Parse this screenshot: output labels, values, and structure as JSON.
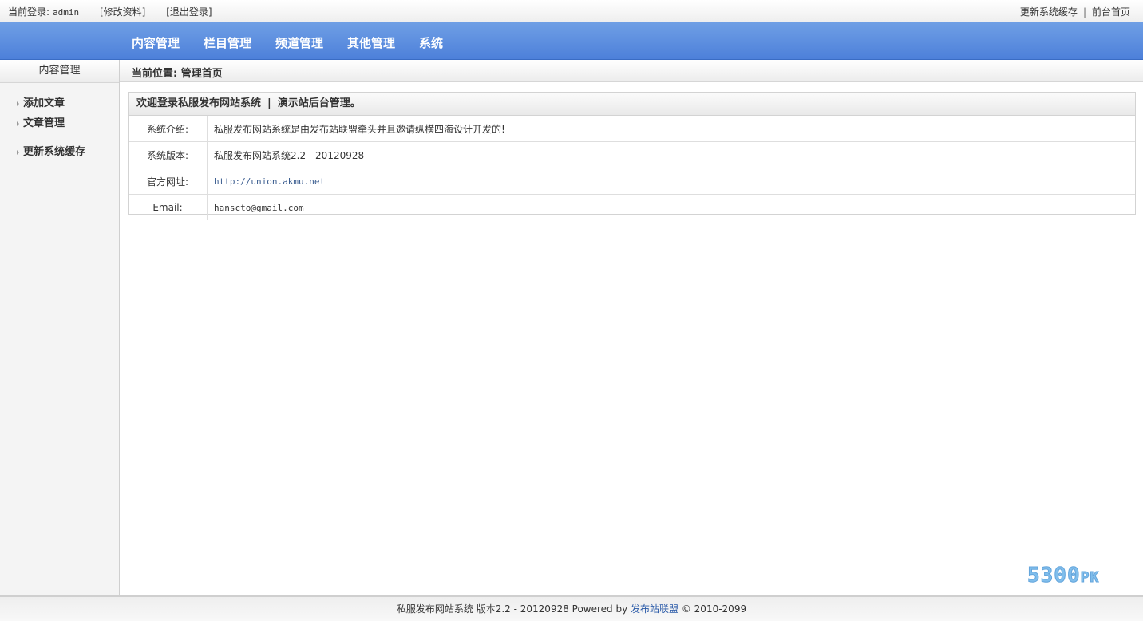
{
  "topbar": {
    "login_label": "当前登录:",
    "username": "admin",
    "edit_profile": "[修改资料]",
    "logout": "[退出登录]",
    "update_cache": "更新系统缓存",
    "separator": "|",
    "front_home": "前台首页"
  },
  "nav": {
    "items": [
      "内容管理",
      "栏目管理",
      "频道管理",
      "其他管理",
      "系统"
    ]
  },
  "sidebar": {
    "title": "内容管理",
    "items": [
      "添加文章",
      "文章管理",
      "更新系统缓存"
    ]
  },
  "breadcrumb": {
    "text": "当前位置: 管理首页"
  },
  "panel": {
    "title_left": "欢迎登录私服发布网站系统",
    "title_bar": "|",
    "title_right": "演示站后台管理。",
    "rows": [
      {
        "label": "系统介绍:",
        "value": "私服发布网站系统是由发布站联盟牵头并且邀请纵横四海设计开发的!"
      },
      {
        "label": "系统版本:",
        "value": "私服发布网站系统2.2 - 20120928"
      },
      {
        "label": "官方网址:",
        "value": "http://union.akmu.net"
      },
      {
        "label": "Email:",
        "value": "hanscto@gmail.com"
      }
    ]
  },
  "footer": {
    "prefix": "私服发布网站系统 版本2.2 - 20120928 Powered by ",
    "link": "发布站联盟",
    "suffix": " © 2010-2099"
  },
  "watermark": {
    "main": "5300",
    "small": "PK"
  },
  "colors": {
    "nav_top": "#6f9fe5",
    "nav_bottom": "#4d80da",
    "link": "#2a5aa8"
  }
}
